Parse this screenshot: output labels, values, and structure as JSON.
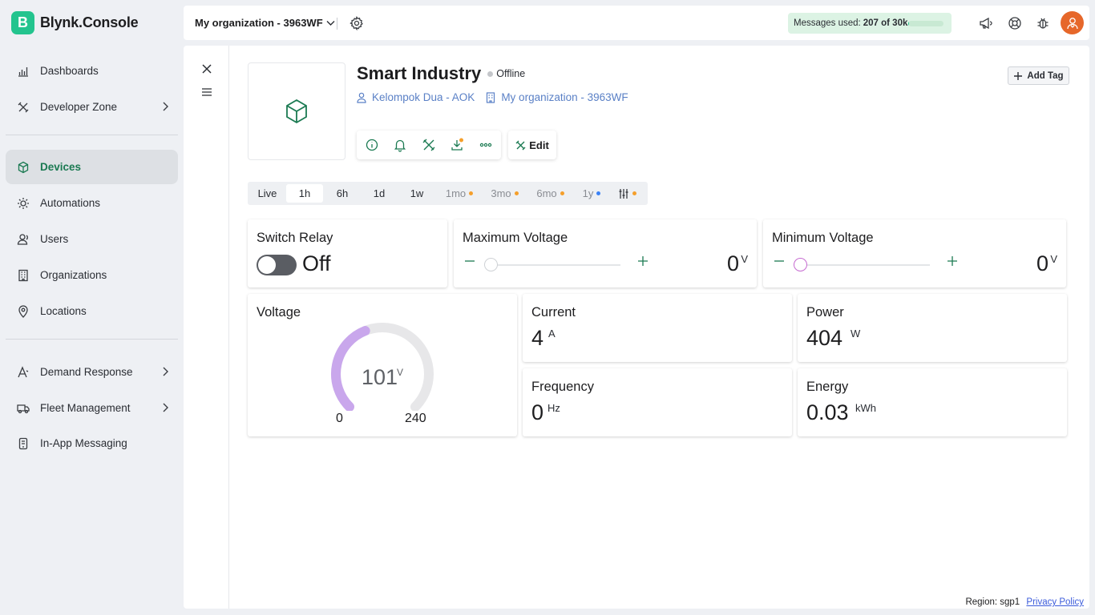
{
  "brand": {
    "logo_letter": "B",
    "name": "Blynk.Console",
    "color": "#23c48e"
  },
  "sidebar": {
    "items": [
      {
        "label": "Dashboards",
        "icon": "chart-icon"
      },
      {
        "label": "Developer Zone",
        "icon": "tools-icon",
        "has_chevron": true
      },
      {
        "label": "Devices",
        "icon": "cube-icon",
        "active": true
      },
      {
        "label": "Automations",
        "icon": "automation-icon"
      },
      {
        "label": "Users",
        "icon": "users-icon"
      },
      {
        "label": "Organizations",
        "icon": "building-icon"
      },
      {
        "label": "Locations",
        "icon": "location-pin-icon"
      },
      {
        "label": "Demand Response",
        "icon": "signal-icon",
        "has_chevron": true
      },
      {
        "label": "Fleet Management",
        "icon": "truck-icon",
        "has_chevron": true
      },
      {
        "label": "In-App Messaging",
        "icon": "phone-message-icon"
      }
    ]
  },
  "topbar": {
    "org_name": "My organization - 3963WF",
    "messages_label": "Messages used:",
    "messages_value": "207 of 30k",
    "messages_fraction": 0.0069
  },
  "device": {
    "name": "Smart Industry",
    "status": "Offline",
    "owner": "Kelompok Dua - AOK",
    "organization": "My organization - 3963WF",
    "edit_label": "Edit",
    "add_tag_label": "Add Tag"
  },
  "time_tabs": [
    {
      "label": "Live"
    },
    {
      "label": "1h",
      "selected": true
    },
    {
      "label": "6h"
    },
    {
      "label": "1d"
    },
    {
      "label": "1w"
    },
    {
      "label": "1mo",
      "dot": "#f59f2b"
    },
    {
      "label": "3mo",
      "dot": "#f59f2b"
    },
    {
      "label": "6mo",
      "dot": "#f59f2b"
    },
    {
      "label": "1y",
      "dot": "#3b82f6"
    }
  ],
  "widgets": {
    "switch_relay": {
      "title": "Switch Relay",
      "state": "Off"
    },
    "max_voltage": {
      "title": "Maximum Voltage",
      "value": "0",
      "unit": "V"
    },
    "min_voltage": {
      "title": "Minimum Voltage",
      "value": "0",
      "unit": "V"
    },
    "voltage": {
      "title": "Voltage",
      "value": "101",
      "unit": "V",
      "min": "0",
      "max": "240",
      "fraction": 0.42
    },
    "current": {
      "title": "Current",
      "value": "4",
      "unit": "A"
    },
    "power": {
      "title": "Power",
      "value": "404",
      "unit": "W"
    },
    "frequency": {
      "title": "Frequency",
      "value": "0",
      "unit": "Hz"
    },
    "energy": {
      "title": "Energy",
      "value": "0.03",
      "unit": "kWh"
    }
  },
  "footer": {
    "region": "Region: sgp1",
    "privacy": "Privacy Policy"
  }
}
